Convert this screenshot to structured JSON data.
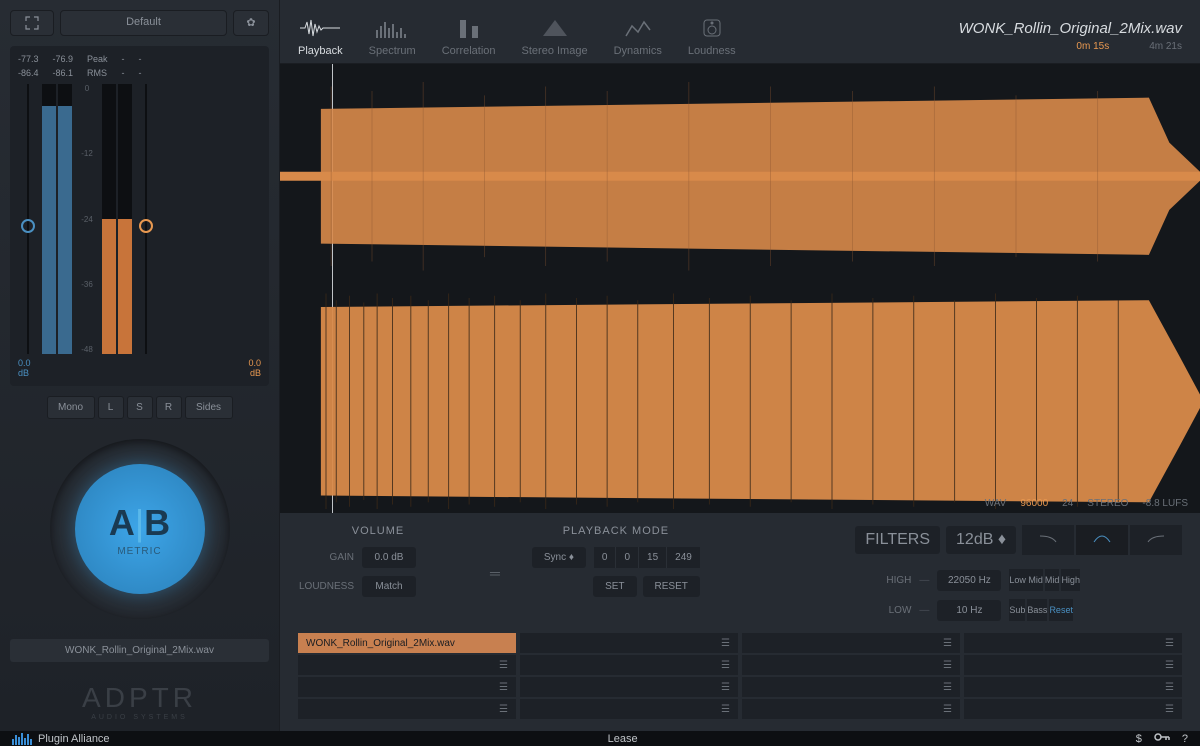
{
  "header": {
    "preset": "Default",
    "filename": "WONK_Rollin_Original_2Mix.wav",
    "time_current": "0m 15s",
    "time_total": "4m 21s"
  },
  "tabs": [
    {
      "label": "Playback",
      "active": true
    },
    {
      "label": "Spectrum",
      "active": false
    },
    {
      "label": "Correlation",
      "active": false
    },
    {
      "label": "Stereo Image",
      "active": false
    },
    {
      "label": "Dynamics",
      "active": false
    },
    {
      "label": "Loudness",
      "active": false
    }
  ],
  "meters": {
    "peak_l": "-77.3",
    "peak_r": "-76.9",
    "peak_label": "Peak",
    "rms_l": "-86.4",
    "rms_r": "-86.1",
    "rms_label": "RMS",
    "dash": "-",
    "left_val": "0.0",
    "right_val": "0.0",
    "unit": "dB",
    "scale": [
      "0",
      "-12",
      "-24",
      "-36",
      "-48"
    ]
  },
  "channels": {
    "mono": "Mono",
    "l": "L",
    "s": "S",
    "r": "R",
    "sides": "Sides"
  },
  "ab": {
    "a": "A",
    "b": "B",
    "metric": "METRIC"
  },
  "sidebar_file": "WONK_Rollin_Original_2Mix.wav",
  "logo": {
    "brand": "ADPTR",
    "sub": "AUDIO SYSTEMS"
  },
  "wave_info": {
    "format": "WAV",
    "sample_rate": "96000",
    "bit": "24",
    "channels": "STEREO",
    "lufs": "-8.8 LUFS"
  },
  "controls": {
    "volume_title": "VOLUME",
    "gain_label": "GAIN",
    "gain_val": "0.0 dB",
    "loudness_label": "LOUDNESS",
    "match": "Match",
    "playback_title": "PLAYBACK MODE",
    "sync": "Sync",
    "tc": [
      "0",
      "0",
      "15",
      "249"
    ],
    "set": "SET",
    "reset": "RESET",
    "filters_label": "FILTERS",
    "filter_db": "12dB",
    "high_label": "HIGH",
    "high_val": "22050 Hz",
    "low_label": "LOW",
    "low_val": "10 Hz",
    "filter_presets": [
      "Low Mid",
      "Mid",
      "High",
      "Sub",
      "Bass",
      "Reset"
    ]
  },
  "playlist": {
    "loaded_file": "WONK_Rollin_Original_2Mix.wav"
  },
  "footer": {
    "brand": "Plugin Alliance",
    "license": "Lease",
    "icons": {
      "dollar": "$",
      "key": "⚿",
      "help": "?"
    }
  }
}
